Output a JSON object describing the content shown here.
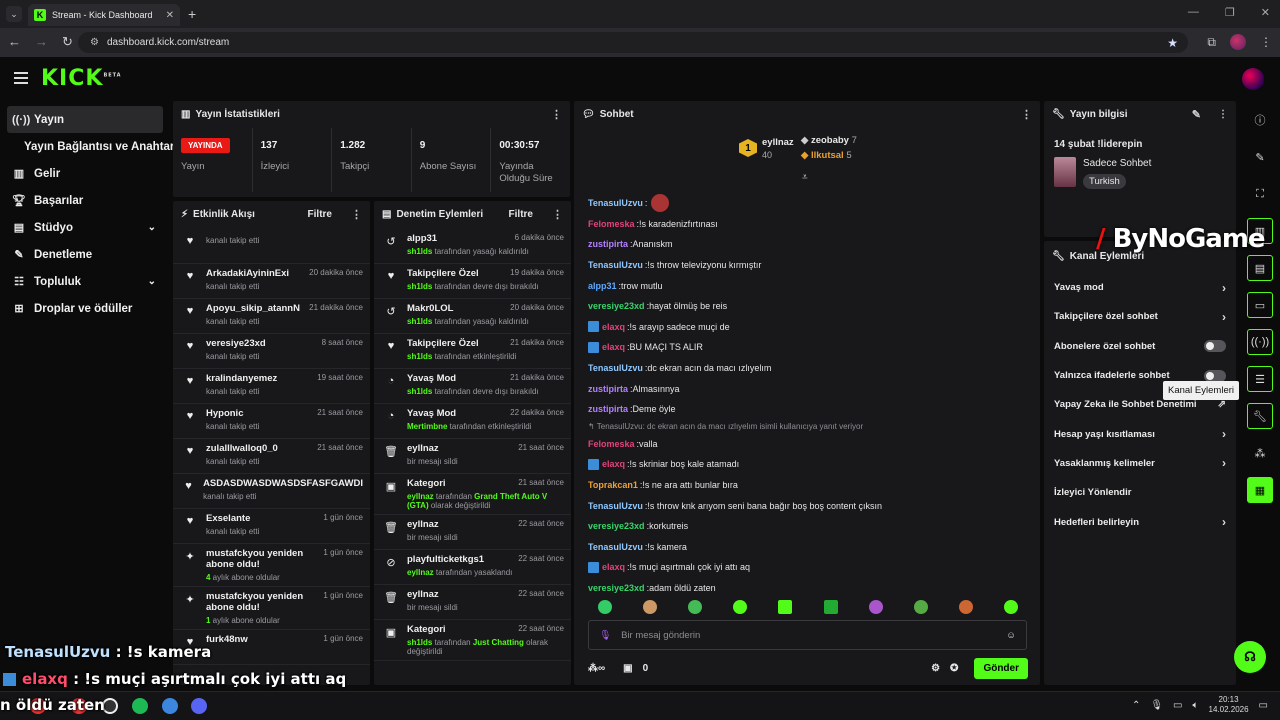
{
  "browser": {
    "tab_title": "Stream - Kick Dashboard",
    "url": "dashboard.kick.com/stream"
  },
  "header": {
    "logo": "KICK",
    "logo_tag": "BETA"
  },
  "sidebar": {
    "items": [
      {
        "label": "Yayın",
        "icon": "broadcast-icon"
      },
      {
        "label": "Yayın Bağlantısı ve Anahtarı"
      },
      {
        "label": "Gelir",
        "icon": "chart-icon"
      },
      {
        "label": "Başarılar",
        "icon": "trophy-icon"
      },
      {
        "label": "Stüdyo",
        "icon": "studio-icon"
      },
      {
        "label": "Denetleme",
        "icon": "wrench-icon"
      },
      {
        "label": "Topluluk",
        "icon": "community-icon"
      },
      {
        "label": "Droplar ve ödüller",
        "icon": "gift-icon"
      }
    ]
  },
  "stats": {
    "title": "Yayın İstatistikleri",
    "live_badge": "YAYINDA",
    "cells": [
      {
        "value": "",
        "label": "Yayın"
      },
      {
        "value": "137",
        "label": "İzleyici"
      },
      {
        "value": "1.282",
        "label": "Takipçi"
      },
      {
        "value": "9",
        "label": "Abone Sayısı"
      },
      {
        "value": "00:30:57",
        "label": "Yayında Olduğu Süre"
      }
    ]
  },
  "activity": {
    "title": "Etkinlik Akışı",
    "filter": "Filtre",
    "items": [
      {
        "name": "",
        "time": "",
        "sub": "kanalı takip etti",
        "icon": "heart-icon"
      },
      {
        "name": "ArkadakiAyininExi",
        "time": "20 dakika önce",
        "sub": "kanalı takip etti",
        "icon": "heart-icon"
      },
      {
        "name": "Apoyu_sikip_atannN",
        "time": "21 dakika önce",
        "sub": "kanalı takip etti",
        "icon": "heart-icon"
      },
      {
        "name": "veresiye23xd",
        "time": "8 saat önce",
        "sub": "kanalı takip etti",
        "icon": "heart-icon"
      },
      {
        "name": "kralindanyemez",
        "time": "19 saat önce",
        "sub": "kanalı takip etti",
        "icon": "heart-icon"
      },
      {
        "name": "Hyponic",
        "time": "21 saat önce",
        "sub": "kanalı takip etti",
        "icon": "heart-icon"
      },
      {
        "name": "zulalllwalloq0_0",
        "time": "21 saat önce",
        "sub": "kanalı takip etti",
        "icon": "heart-icon"
      },
      {
        "name": "ASDASDWASDWASDSFASFGAWDI",
        "time": "",
        "sub": "kanalı takip etti",
        "icon": "heart-icon"
      },
      {
        "name": "Exselante",
        "time": "1 gün önce",
        "sub": "kanalı takip etti",
        "icon": "heart-icon"
      },
      {
        "name": "mustafckyou yeniden abone oldu!",
        "time": "1 gün önce",
        "sub_green": "4",
        "sub": " aylık abone oldular",
        "icon": "sparkle-icon"
      },
      {
        "name": "mustafckyou yeniden abone oldu!",
        "time": "1 gün önce",
        "sub_green": "1",
        "sub": " aylık abone oldular",
        "icon": "sparkle-icon"
      },
      {
        "name": "furk48nw",
        "time": "1 gün önce",
        "sub": "",
        "icon": "heart-icon"
      }
    ]
  },
  "modlog": {
    "title": "Denetim Eylemleri",
    "filter": "Filtre",
    "items": [
      {
        "name": "alpp31",
        "time": "6 dakika önce",
        "actor": "sh1lds",
        "sub": " tarafından yasağı kaldırıldı",
        "icon": "undo-icon"
      },
      {
        "name": "Takipçilere Özel",
        "time": "19 dakika önce",
        "actor": "sh1lds",
        "sub": " tarafından devre dışı bırakıldı",
        "icon": "heart-icon"
      },
      {
        "name": "Makr0LOL",
        "time": "20 dakika önce",
        "actor": "sh1lds",
        "sub": " tarafından yasağı kaldırıldı",
        "icon": "undo-icon"
      },
      {
        "name": "Takipçilere Özel",
        "time": "21 dakika önce",
        "actor": "sh1lds",
        "sub": " tarafından etkinleştirildi",
        "icon": "heart-icon"
      },
      {
        "name": "Yavaş Mod",
        "time": "21 dakika önce",
        "actor": "sh1lds",
        "sub": " tarafından devre dışı bırakıldı",
        "icon": "snail-icon"
      },
      {
        "name": "Yavaş Mod",
        "time": "22 dakika önce",
        "actor": "Mertimbne",
        "sub": " tarafından etkinleştirildi",
        "icon": "snail-icon"
      },
      {
        "name": "eyllnaz",
        "time": "21 saat önce",
        "actor": "",
        "sub": "bir mesajı sildi",
        "icon": "trash-icon"
      },
      {
        "name": "Kategori",
        "time": "21 saat önce",
        "actor": "eyllnaz",
        "sub": " tarafından ",
        "extra": "Grand Theft Auto V (GTA)",
        "tail": " olarak değiştirildi",
        "icon": "category-icon"
      },
      {
        "name": "eyllnaz",
        "time": "22 saat önce",
        "actor": "",
        "sub": "bir mesajı sildi",
        "icon": "trash-icon"
      },
      {
        "name": "playfulticketkgs1",
        "time": "22 saat önce",
        "actor": "eyllnaz",
        "sub": " tarafından yasaklandı",
        "icon": "ban-icon"
      },
      {
        "name": "eyllnaz",
        "time": "22 saat önce",
        "actor": "",
        "sub": "bir mesajı sildi",
        "icon": "trash-icon"
      },
      {
        "name": "Kategori",
        "time": "22 saat önce",
        "actor": "sh1lds",
        "sub": " tarafından ",
        "extra": "Just Chatting",
        "tail": " olarak değiştirildi",
        "icon": "category-icon"
      }
    ]
  },
  "chat": {
    "title": "Sohbet",
    "leaders": [
      {
        "rank": "1",
        "name": "eyllnaz",
        "count": "40"
      },
      {
        "name": "zeobaby",
        "count": "7"
      },
      {
        "name": "llkutsal",
        "count": "5"
      }
    ],
    "messages": [
      {
        "user": "TenasulUzvu",
        "color": "#8ec8ff",
        "text": ""
      },
      {
        "user": "Felomeska",
        "color": "#e2427a",
        "text": "!s karadenizfırtınası"
      },
      {
        "user": "zustipirta",
        "color": "#b380ff",
        "text": "Ananıskm"
      },
      {
        "user": "TenasulUzvu",
        "color": "#8ec8ff",
        "text": "!s throw televizyonu kırmıştır"
      },
      {
        "user": "alpp31",
        "color": "#5da9ff",
        "text": "trow mutlu"
      },
      {
        "user": "veresiye23xd",
        "color": "#3ad36b",
        "text": "hayat ölmüş be reis"
      },
      {
        "user": "elaxq",
        "color": "#e2427a",
        "text": "!s arayıp sadece muçi de",
        "badge": true
      },
      {
        "user": "elaxq",
        "color": "#e2427a",
        "text": "BU MAÇI TS ALIR",
        "badge": true
      },
      {
        "user": "TenasulUzvu",
        "color": "#8ec8ff",
        "text": "dc ekran acın da macı ızlıyelım"
      },
      {
        "user": "zustipirta",
        "color": "#b380ff",
        "text": "Almasınnya"
      },
      {
        "user": "zustipirta",
        "color": "#b380ff",
        "text": "Deme öyle"
      },
      {
        "reply": "↰ TenasulUzvu: dc ekran acın da macı ızlıyelım isimli kullanıcıya yanıt veriyor"
      },
      {
        "user": "Felomeska",
        "color": "#e2427a",
        "text": "valla"
      },
      {
        "user": "elaxq",
        "color": "#e2427a",
        "text": "!s skriniar boş kale atamadı",
        "badge": true
      },
      {
        "user": "Toprakcan1",
        "color": "#f0a030",
        "text": "!s ne ara attı bunlar bıra"
      },
      {
        "user": "TenasulUzvu",
        "color": "#8ec8ff",
        "text": "!s throw knk arıyom seni bana bağır boş boş content çıksın"
      },
      {
        "user": "veresiye23xd",
        "color": "#3ad36b",
        "text": "korkutreis"
      },
      {
        "user": "TenasulUzvu",
        "color": "#8ec8ff",
        "text": "!s kamera"
      },
      {
        "user": "elaxq",
        "color": "#e2427a",
        "text": "!s muçi aşırtmalı çok iyi attı aq",
        "badge": true
      },
      {
        "user": "veresiye23xd",
        "color": "#3ad36b",
        "text": "adam öldü zaten"
      }
    ],
    "input_placeholder": "Bir mesaj gönderin",
    "points": "0",
    "send_label": "Gönder"
  },
  "info": {
    "title": "Yayın bilgisi",
    "stream_title": "14 şubat !liderepin",
    "category": "Sadece Sohbet",
    "language": "Turkish"
  },
  "channel": {
    "title": "Kanal Eylemleri",
    "rows": [
      {
        "label": "Yavaş mod",
        "ctrl": "chevron"
      },
      {
        "label": "Takipçilere özel sohbet",
        "ctrl": "chevron"
      },
      {
        "label": "Abonelere özel sohbet",
        "ctrl": "toggle"
      },
      {
        "label": "Yalnızca ifadelerle sohbet",
        "ctrl": "toggle"
      },
      {
        "label": "Yapay Zeka ile Sohbet Denetimi",
        "ctrl": "external"
      },
      {
        "label": "Hesap yaşı kısıtlaması",
        "ctrl": "chevron"
      },
      {
        "label": "Yasaklanmış kelimeler",
        "ctrl": "chevron"
      },
      {
        "label": "İzleyici Yönlendir",
        "ctrl": "none"
      },
      {
        "label": "Hedefleri belirleyin",
        "ctrl": "chevron"
      }
    ],
    "tooltip": "Kanal Eylemleri"
  },
  "watermark": "ByNoGame",
  "overlay": {
    "line1_user": "TenasulUzvu",
    "line1_text": " : !s kamera",
    "line2_user": "elaxq",
    "line2_text": " : !s muçi aşırtmalı çok iyi attı aq",
    "line3_text": "n öldü zaten"
  },
  "taskbar": {
    "time": "20:13",
    "date": "14.02.2026"
  },
  "colors": {
    "accent": "#53fc18",
    "live": "#e91916",
    "panel": "#18181b"
  }
}
